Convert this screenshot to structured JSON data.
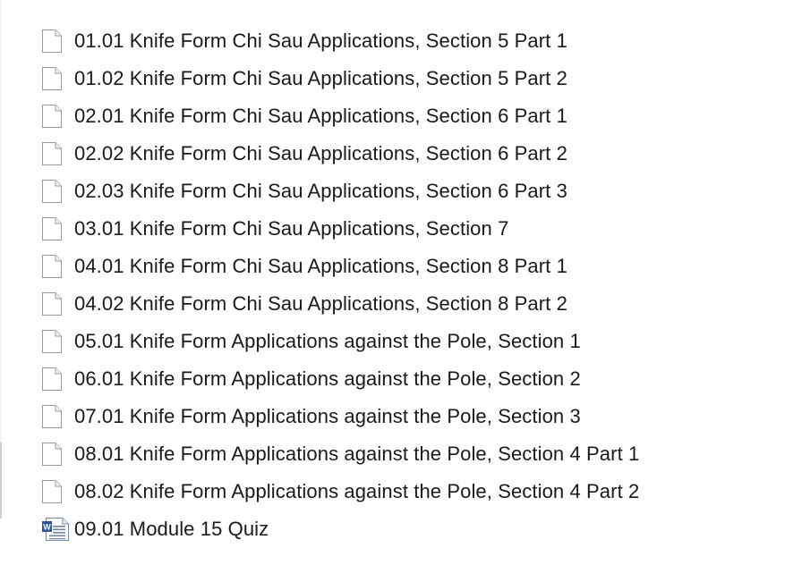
{
  "files": [
    {
      "name": "01.01 Knife Form Chi Sau Applications, Section 5 Part 1",
      "icon": "blank-document-icon"
    },
    {
      "name": "01.02 Knife Form Chi Sau Applications, Section 5 Part 2",
      "icon": "blank-document-icon"
    },
    {
      "name": "02.01 Knife Form Chi Sau Applications, Section 6 Part 1",
      "icon": "blank-document-icon"
    },
    {
      "name": "02.02 Knife Form Chi Sau Applications, Section 6 Part 2",
      "icon": "blank-document-icon"
    },
    {
      "name": "02.03 Knife Form Chi Sau Applications, Section 6 Part 3",
      "icon": "blank-document-icon"
    },
    {
      "name": "03.01 Knife Form Chi Sau Applications, Section 7",
      "icon": "blank-document-icon"
    },
    {
      "name": "04.01 Knife Form Chi Sau Applications, Section 8 Part 1",
      "icon": "blank-document-icon"
    },
    {
      "name": "04.02 Knife Form Chi Sau Applications, Section 8 Part 2",
      "icon": "blank-document-icon"
    },
    {
      "name": "05.01 Knife Form Applications against the Pole, Section 1",
      "icon": "blank-document-icon"
    },
    {
      "name": "06.01 Knife Form Applications against the Pole, Section 2",
      "icon": "blank-document-icon"
    },
    {
      "name": "07.01 Knife Form Applications against the Pole, Section 3",
      "icon": "blank-document-icon"
    },
    {
      "name": "08.01 Knife Form Applications against the Pole, Section 4 Part 1",
      "icon": "blank-document-icon"
    },
    {
      "name": "08.02 Knife Form Applications against the Pole, Section 4 Part 2",
      "icon": "blank-document-icon"
    },
    {
      "name": "09.01 Module 15 Quiz",
      "icon": "word-document-icon"
    }
  ],
  "colors": {
    "text": "#1a1a1a",
    "background": "#ffffff",
    "icon_border": "#9a9a9a",
    "word_blue": "#2b579a"
  }
}
